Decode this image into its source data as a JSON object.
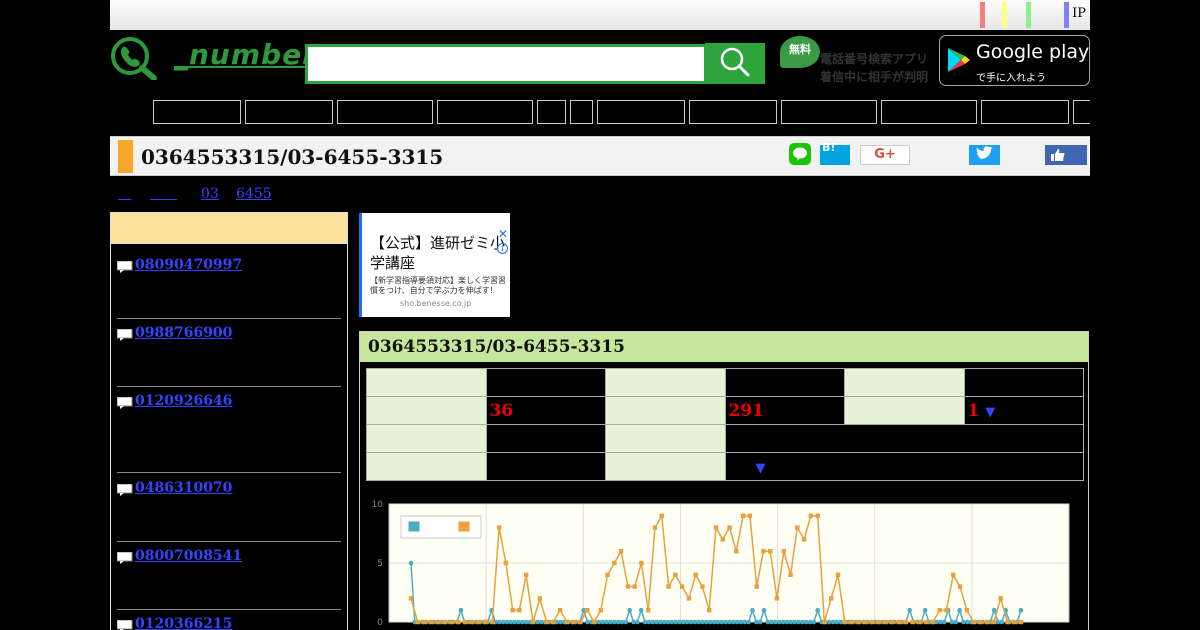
{
  "topbar": {
    "ip_label": "IP",
    "color_bars": [
      "#f08080",
      "#ffff80",
      "#90ee90",
      "#8080ff"
    ]
  },
  "header": {
    "logo_text": "_number",
    "search": {
      "placeholder": "",
      "value": ""
    },
    "search_icon": "magnifier-icon",
    "app_promo": {
      "badge": "無料",
      "line1": "電話番号検索アプリ",
      "line2": "着信中に相手が判明"
    },
    "google_play": {
      "main": "Google play",
      "sub": "で手に入れよう"
    }
  },
  "colors": {
    "brand_green": "#2ea43c",
    "accent_orange": "#f7a82b",
    "link_blue": "#3344ff",
    "value_red": "#e00000"
  },
  "title": {
    "text": "0364553315/03-6455-3315"
  },
  "share": {
    "hatena": "B!",
    "gplus": "G+"
  },
  "breadcrumb": [
    {
      "label": "   "
    },
    {
      "label": "      "
    },
    {
      "label": "03"
    },
    {
      "label": "6455"
    }
  ],
  "sidebar": {
    "items": [
      {
        "number": "08090470997"
      },
      {
        "number": "0988766900"
      },
      {
        "number": "0120926646"
      },
      {
        "number": "0486310070"
      },
      {
        "number": "08007008541"
      },
      {
        "number": "0120366215"
      }
    ]
  },
  "ad": {
    "title": "【公式】進研ゼミ小学講座",
    "description": "【新学習指導要領対応】楽しく学習習慣をつけ、自分で学ぶ力を伸ばす！",
    "url": "sho.benesse.co.jp",
    "close": "✕",
    "info": "i"
  },
  "panel": {
    "title": "0364553315/03-6455-3315",
    "stats": {
      "row2": {
        "v1": "36",
        "v2": "291",
        "v3": "1",
        "arrow": "▼"
      },
      "row4": {
        "arrow": "▼"
      }
    }
  },
  "chart_data": {
    "type": "line",
    "ylim": [
      0,
      10
    ],
    "yticks": [
      "0",
      "5",
      "10"
    ],
    "series": [
      {
        "color": "#4bacc6",
        "values": [
          5,
          0,
          0,
          0,
          0,
          0,
          0,
          0,
          0,
          0,
          0,
          0,
          0,
          1,
          0,
          0,
          0,
          0,
          0,
          0,
          0,
          1,
          0,
          0,
          0,
          0,
          0,
          0,
          0,
          0,
          0,
          0,
          0,
          0,
          0,
          0,
          0,
          0,
          0,
          0,
          0,
          0,
          0,
          0,
          0,
          1,
          0,
          0,
          0,
          0,
          0,
          0,
          0,
          0,
          0,
          0,
          0,
          1,
          0,
          0,
          1,
          0,
          0,
          0,
          0,
          0,
          0,
          0,
          0,
          0,
          0,
          0,
          0,
          0,
          0,
          0,
          0,
          0,
          0,
          0,
          0,
          0,
          0,
          0,
          0,
          0,
          0,
          0,
          0,
          1,
          0,
          0,
          1,
          0,
          0,
          0,
          0,
          0,
          0,
          0,
          0,
          0,
          0,
          0,
          0,
          0,
          1,
          0,
          0,
          0,
          0,
          0,
          0,
          0,
          0,
          0,
          0,
          0,
          0,
          0,
          0,
          0,
          0,
          0,
          0,
          0,
          0,
          0,
          0,
          0,
          1,
          0,
          0,
          0,
          1,
          0,
          0,
          0,
          0,
          0,
          1,
          0,
          0,
          1,
          0,
          0,
          0,
          0,
          0,
          0,
          0,
          0,
          1,
          0,
          0,
          1,
          0,
          0,
          0,
          1
        ]
      },
      {
        "color": "#e8a13c",
        "values": [
          2,
          0,
          0,
          0,
          0,
          0,
          0,
          0,
          0,
          0,
          0,
          0,
          0,
          8,
          5,
          1,
          1,
          4,
          0,
          2,
          0,
          0,
          1,
          0,
          0,
          0,
          1,
          0,
          1,
          4,
          5,
          6,
          3,
          3,
          5,
          1,
          8,
          9,
          3,
          4,
          3,
          2,
          4,
          3,
          1,
          8,
          7,
          8,
          6,
          9,
          9,
          3,
          6,
          6,
          2,
          6,
          4,
          8,
          7,
          9,
          9,
          0,
          2,
          4,
          0,
          0,
          0,
          0,
          0,
          0,
          0,
          0,
          0,
          0,
          0,
          0,
          0,
          0,
          1,
          1,
          4,
          3,
          1,
          0,
          0,
          0,
          0,
          2,
          0,
          0,
          0
        ]
      }
    ]
  }
}
